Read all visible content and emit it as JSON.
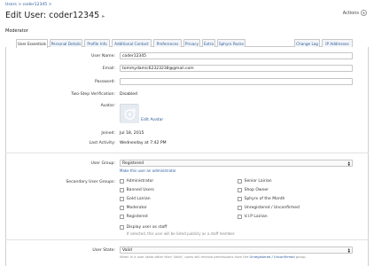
{
  "breadcrumb": {
    "label": "Users >  coder12345 >"
  },
  "header": {
    "title_prefix": "Edit User:",
    "title_user": "coder12345",
    "actions_label": "Actions",
    "subtitle": "Moderator"
  },
  "tabs": [
    {
      "label": "User Essentials",
      "active": true
    },
    {
      "label": "Personal Details"
    },
    {
      "label": "Profile Info"
    },
    {
      "label": "Additional Contact"
    },
    {
      "label": "Preferences"
    },
    {
      "label": "Privacy"
    },
    {
      "label": "Extra"
    },
    {
      "label": "Sphyrx Rocks"
    },
    {
      "label": "Change Log"
    },
    {
      "label": "IP Addresses"
    }
  ],
  "form": {
    "username_label": "User Name:",
    "username_value": "coder12345",
    "email_label": "Email:",
    "email_value": "tommydamic62323238@gmail.com",
    "password_label": "Password:",
    "password_value": "",
    "twostep_label": "Two-Step Verification:",
    "twostep_value": "Disabled",
    "avatar_label": "Avatar:",
    "edit_avatar": "Edit Avatar",
    "joined_label": "Joined:",
    "joined_value": "Jul 18, 2015",
    "last_activity_label": "Last Activity:",
    "last_activity_value": "Wednesday at 7:42 PM",
    "user_group_label": "User Group:",
    "user_group_value": "Registered",
    "make_admin_link": "Make this user an administrator",
    "secondary_groups_label": "Secondary User Groups:",
    "secondary_groups_left": [
      "Administrator",
      "Banned Users",
      "Gold Lairian",
      "Moderator",
      "Registered"
    ],
    "secondary_groups_right": [
      "Senior Lairian",
      "Shop Owner",
      "Sphyrx of the Month",
      "Unregistered / Unconfirmed",
      "V.I.P Lairian"
    ],
    "display_staff_label": "Display user as staff",
    "display_staff_note": "If selected, this user will be listed publicly as a staff member.",
    "user_state_label": "User State:",
    "user_state_value": "Valid",
    "user_state_note_a": "When in a user state other than 'Valid', users will receive permissions from the",
    "user_state_note_link": "Unregistered / Unconfirmed",
    "user_state_note_b": "group."
  }
}
